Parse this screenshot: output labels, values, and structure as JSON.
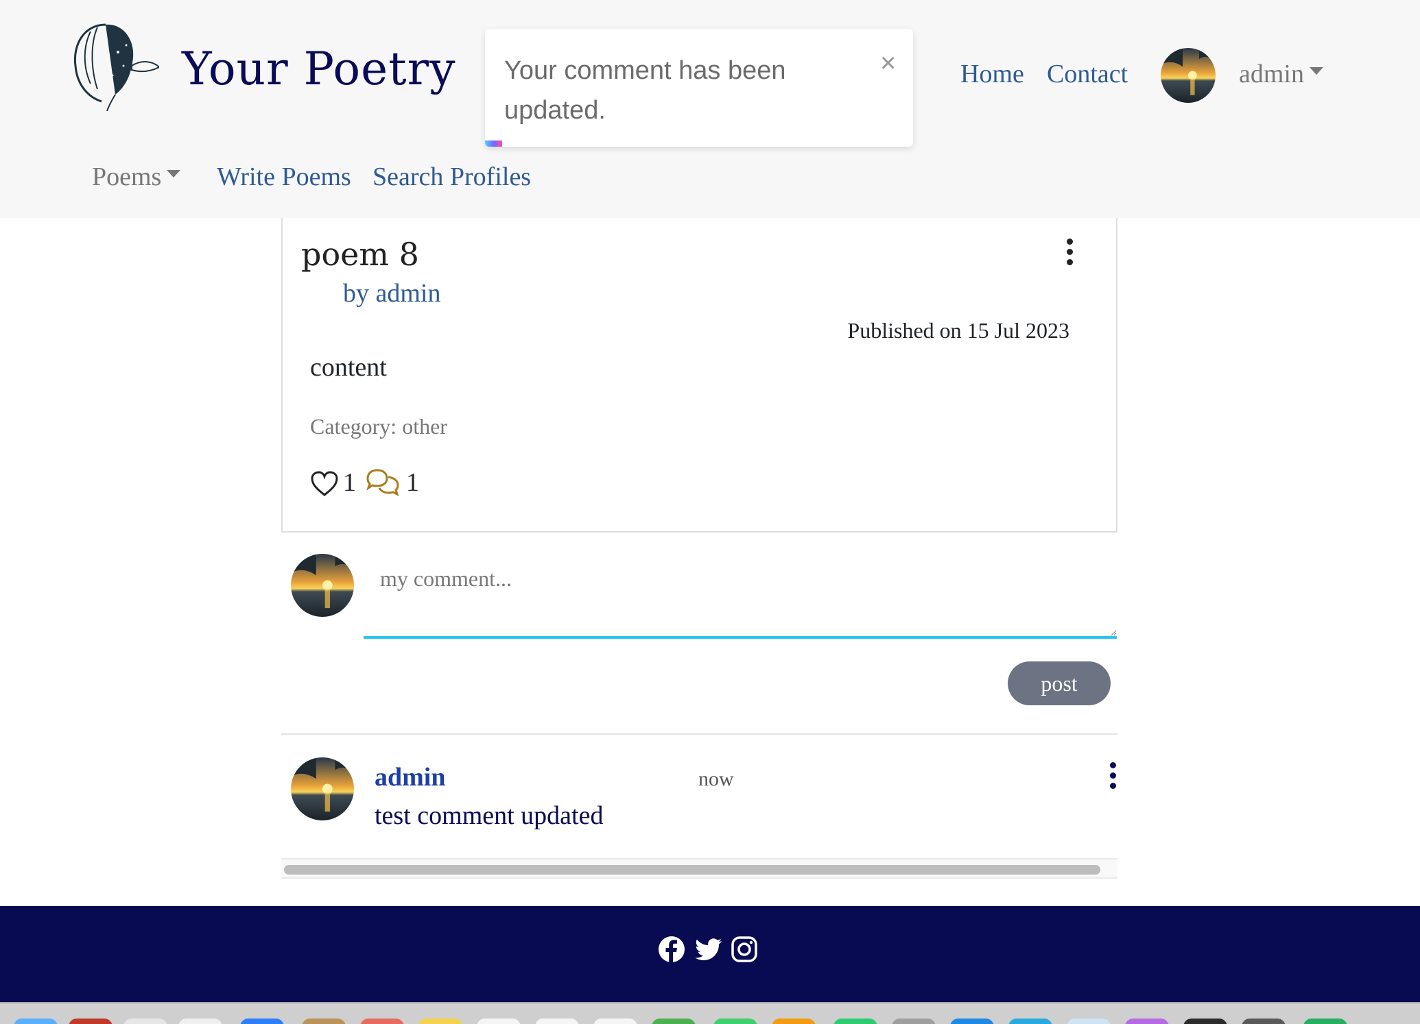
{
  "header": {
    "brand": "Your Poetry",
    "nav": {
      "home": "Home",
      "contact": "Contact"
    },
    "user": "admin",
    "subnav": {
      "poems": "Poems",
      "write": "Write Poems",
      "search": "Search Profiles"
    }
  },
  "toast": {
    "message": "Your comment has been updated.",
    "close": "×",
    "progress": 0.04
  },
  "poem": {
    "title": "poem 8",
    "author": "by admin",
    "published": "Published on 15 Jul 2023",
    "content": "content",
    "category": "Category: other",
    "likes": "1",
    "comments": "1"
  },
  "comment_form": {
    "placeholder": "my comment...",
    "post_label": "post"
  },
  "comments": [
    {
      "author": "admin",
      "time": "now",
      "body": "test comment updated"
    }
  ],
  "colors": {
    "brand": "#0a0b57",
    "link": "#2f5b92",
    "footer": "#080a52",
    "accent": "#2bc4ee",
    "button": "#6c7382"
  },
  "icons": [
    "woman-logo-icon",
    "close-icon",
    "kebab-icon",
    "heart-icon",
    "comments-icon",
    "facebook-icon",
    "twitter-icon",
    "instagram-icon"
  ]
}
